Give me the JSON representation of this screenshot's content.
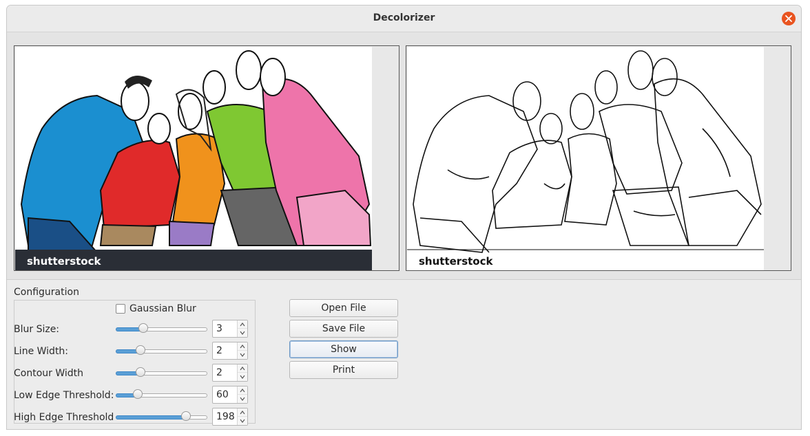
{
  "window": {
    "title": "Decolorizer"
  },
  "images": {
    "source_watermark": "shutterstock",
    "edges_watermark": "shutterstock"
  },
  "config": {
    "group_label": "Configuration",
    "gaussian_blur": {
      "label": "Gaussian Blur",
      "checked": false
    },
    "rows": [
      {
        "label": "Blur Size:",
        "value": "3",
        "level": 0.3
      },
      {
        "label": "Line Width:",
        "value": "2",
        "level": 0.27
      },
      {
        "label": "Contour Width",
        "value": "2",
        "level": 0.27
      },
      {
        "label": "Low Edge Threshold:",
        "value": "60",
        "level": 0.24
      },
      {
        "label": "High Edge Threshold",
        "value": "198",
        "level": 0.77
      }
    ]
  },
  "buttons": {
    "open": "Open File",
    "save": "Save File",
    "show": "Show",
    "print": "Print"
  }
}
